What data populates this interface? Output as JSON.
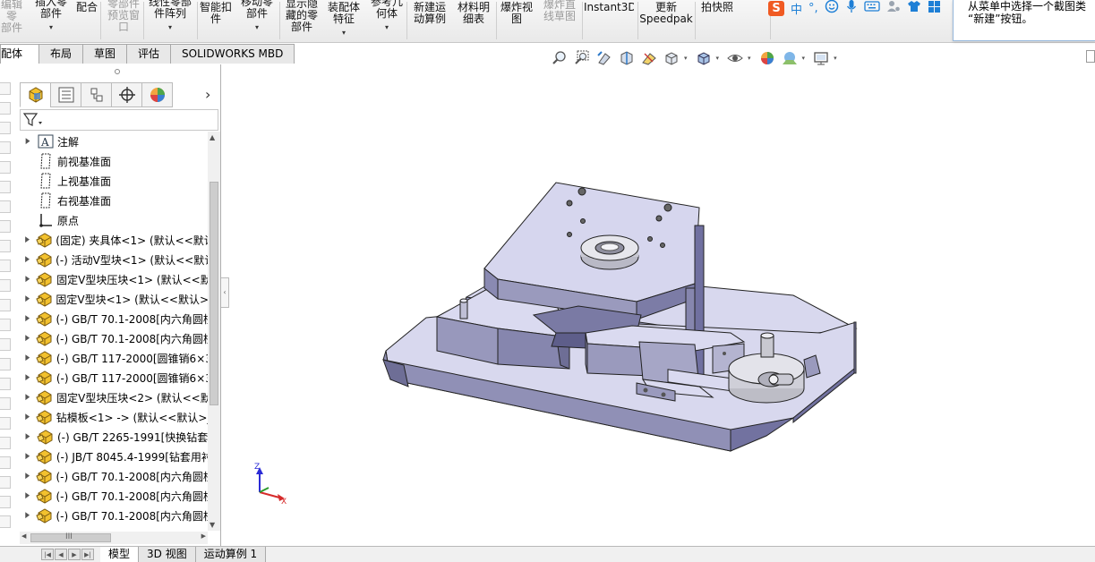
{
  "ribbon": {
    "buttons": [
      {
        "label": "编辑零\n部件",
        "disabled": true
      },
      {
        "label": "插入零\n部件",
        "disabled": false,
        "dropdown": true
      },
      {
        "label": "配合",
        "disabled": false
      },
      {
        "label": "零部件\n预览窗\n口",
        "disabled": true
      },
      {
        "label": "线性零部\n件阵列",
        "disabled": false,
        "dropdown": true
      },
      {
        "label": "智能扣\n件",
        "disabled": false
      },
      {
        "label": "移动零\n部件",
        "disabled": false,
        "dropdown": true
      },
      {
        "label": "显示隐\n藏的零\n部件",
        "disabled": false
      },
      {
        "label": "装配体\n特征",
        "disabled": false,
        "dropdown": true
      },
      {
        "label": "参考几\n何体",
        "disabled": false,
        "dropdown": true
      },
      {
        "label": "新建运\n动算例",
        "disabled": false
      },
      {
        "label": "材料明\n细表",
        "disabled": false
      },
      {
        "label": "爆炸视\n图",
        "disabled": false
      },
      {
        "label": "爆炸直\n线草图",
        "disabled": true
      },
      {
        "label": "Instant3D",
        "disabled": false
      },
      {
        "label": "更新\nSpeedpak",
        "disabled": false
      },
      {
        "label": "拍快照",
        "disabled": false
      }
    ],
    "dropdown_glyph": "▾"
  },
  "ime": {
    "logo": "S",
    "lang": "中",
    "punct": "°,"
  },
  "tooltip": {
    "line1": "从菜单中选择一个截图类",
    "line2": "“新建”按钮。"
  },
  "command_tabs": [
    "装配体",
    "布局",
    "草图",
    "评估",
    "SOLIDWORKS MBD"
  ],
  "feature_tree": {
    "nodes": [
      {
        "label": "注解",
        "icon": "annotation-icon",
        "expand": true
      },
      {
        "label": "前视基准面",
        "icon": "plane-icon",
        "expand": false
      },
      {
        "label": "上视基准面",
        "icon": "plane-icon",
        "expand": false
      },
      {
        "label": "右视基准面",
        "icon": "plane-icon",
        "expand": false
      },
      {
        "label": "原点",
        "icon": "origin-icon",
        "expand": false
      },
      {
        "label": "(固定) 夹具体<1> (默认<<默认",
        "icon": "part-icon",
        "expand": true
      },
      {
        "label": "(-) 活动V型块<1> (默认<<默认",
        "icon": "part-icon",
        "expand": true
      },
      {
        "label": "固定V型块压块<1> (默认<<默",
        "icon": "part-icon",
        "expand": true
      },
      {
        "label": "固定V型块<1> (默认<<默认>_",
        "icon": "part-icon",
        "expand": true
      },
      {
        "label": "(-) GB/T 70.1-2008[内六角圆柱",
        "icon": "part-icon",
        "expand": true
      },
      {
        "label": "(-) GB/T 70.1-2008[内六角圆柱",
        "icon": "part-icon",
        "expand": true
      },
      {
        "label": "(-) GB/T 117-2000[圆锥销6×3",
        "icon": "part-icon",
        "expand": true
      },
      {
        "label": "(-) GB/T 117-2000[圆锥销6×3",
        "icon": "part-icon",
        "expand": true
      },
      {
        "label": "固定V型块压块<2> (默认<<默",
        "icon": "part-icon",
        "expand": true
      },
      {
        "label": "钻模板<1> -> (默认<<默认>_",
        "icon": "part-icon",
        "expand": true
      },
      {
        "label": "(-) GB/T 2265-1991[快换钻套",
        "icon": "part-icon",
        "expand": true
      },
      {
        "label": "(-) JB/T 8045.4-1999[钻套用衬",
        "icon": "part-icon",
        "expand": true
      },
      {
        "label": "(-) GB/T 70.1-2008[内六角圆柱",
        "icon": "part-icon",
        "expand": true
      },
      {
        "label": "(-) GB/T 70.1-2008[内六角圆柱",
        "icon": "part-icon",
        "expand": true
      },
      {
        "label": "(-) GB/T 70.1-2008[内六角圆柱",
        "icon": "part-icon",
        "expand": true
      }
    ]
  },
  "hscroll_label": "III",
  "bottom_tabs": [
    "模型",
    "3D 视图",
    "运动算例 1"
  ],
  "triad": {
    "z": "Z",
    "x": "X"
  },
  "colors": {
    "part_face_top": "#dcdcf0",
    "part_face_side": "#9c9cc0",
    "part_face_dark": "#6e6e96",
    "icon_yellow": "#f2c12e",
    "accent_blue": "#1e7fd6"
  }
}
